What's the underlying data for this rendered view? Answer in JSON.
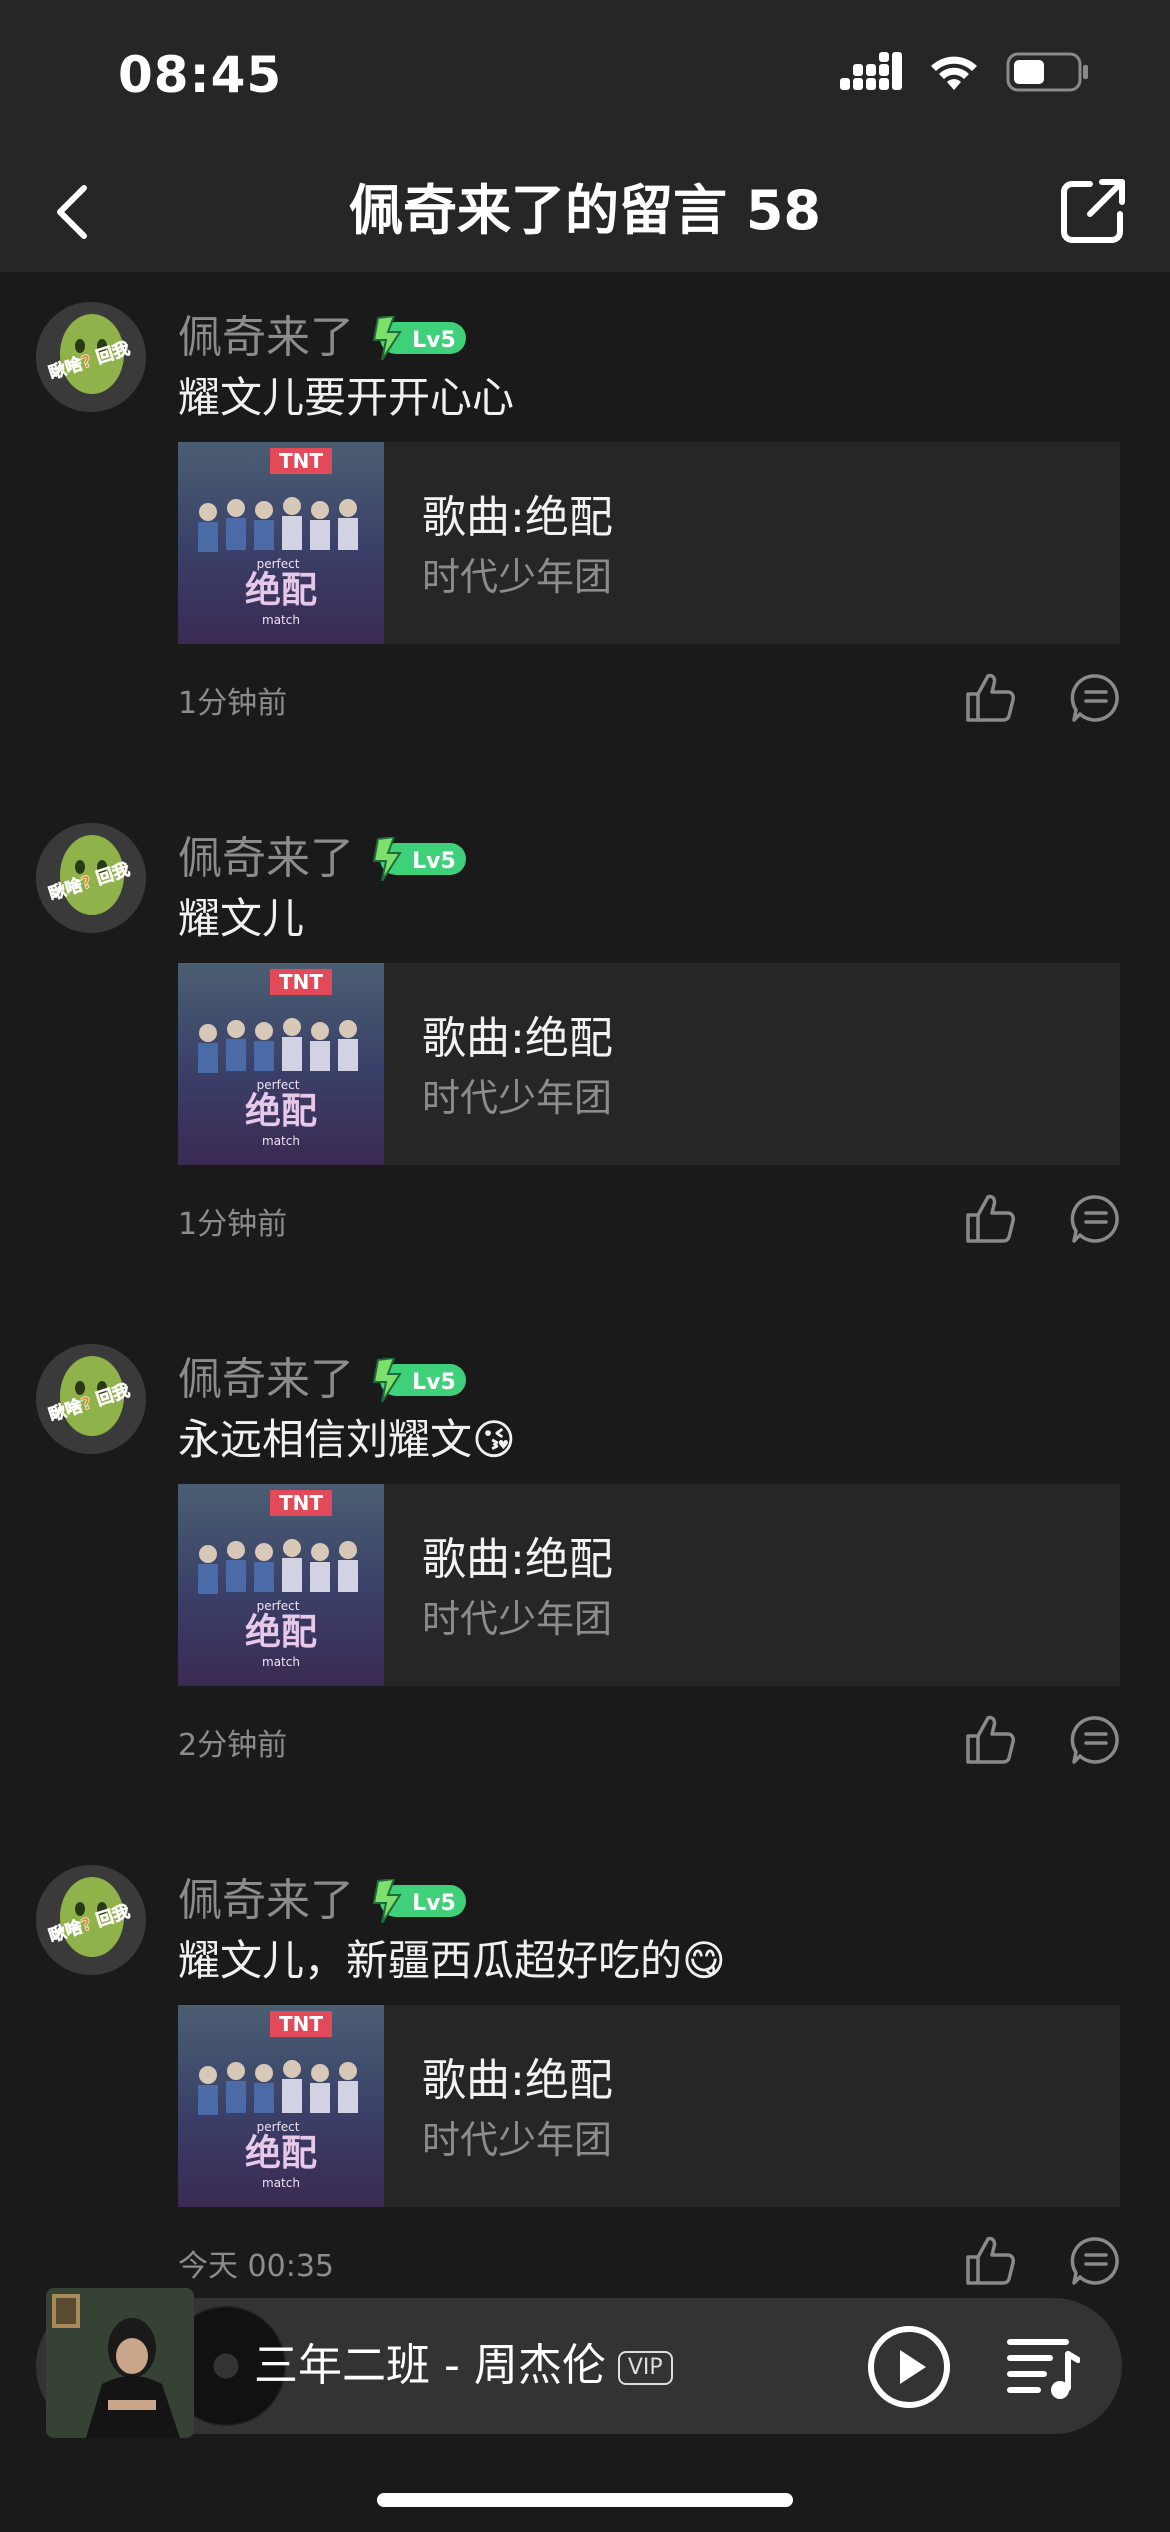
{
  "status_bar": {
    "time": "08:45"
  },
  "header": {
    "title": "佩奇来了的留言 58"
  },
  "comments": [
    {
      "username": "佩奇来了",
      "level": "Lv5",
      "text": "耀文儿要开开心心",
      "song_title": "歌曲:绝配",
      "song_artist": "时代少年团",
      "time": "1分钟前"
    },
    {
      "username": "佩奇来了",
      "level": "Lv5",
      "text": "耀文儿",
      "song_title": "歌曲:绝配",
      "song_artist": "时代少年团",
      "time": "1分钟前"
    },
    {
      "username": "佩奇来了",
      "level": "Lv5",
      "text": "永远相信刘耀文😘",
      "song_title": "歌曲:绝配",
      "song_artist": "时代少年团",
      "time": "2分钟前"
    },
    {
      "username": "佩奇来了",
      "level": "Lv5",
      "text": "耀文儿，新疆西瓜超好吃的😋",
      "song_title": "歌曲:绝配",
      "song_artist": "时代少年团",
      "time": "今天 00:35"
    }
  ],
  "avatar_badge_text": "瞅啥? 回我",
  "cover_art_text": {
    "brand": "TNT",
    "title_cn": "绝配",
    "subtitle_top": "perfect",
    "subtitle_bottom": "match"
  },
  "player": {
    "now_playing": "三年二班 - 周杰伦",
    "vip_label": "VIP"
  },
  "colors": {
    "background": "#1a1a1a",
    "card": "#262626",
    "accent_green": "#3fd07a",
    "muted_text": "#8c8c8c"
  },
  "icons": [
    "back-icon",
    "share-icon",
    "signal-icon",
    "wifi-icon",
    "battery-icon",
    "lightning-icon",
    "like-icon",
    "reply-icon",
    "play-icon",
    "playlist-icon"
  ]
}
